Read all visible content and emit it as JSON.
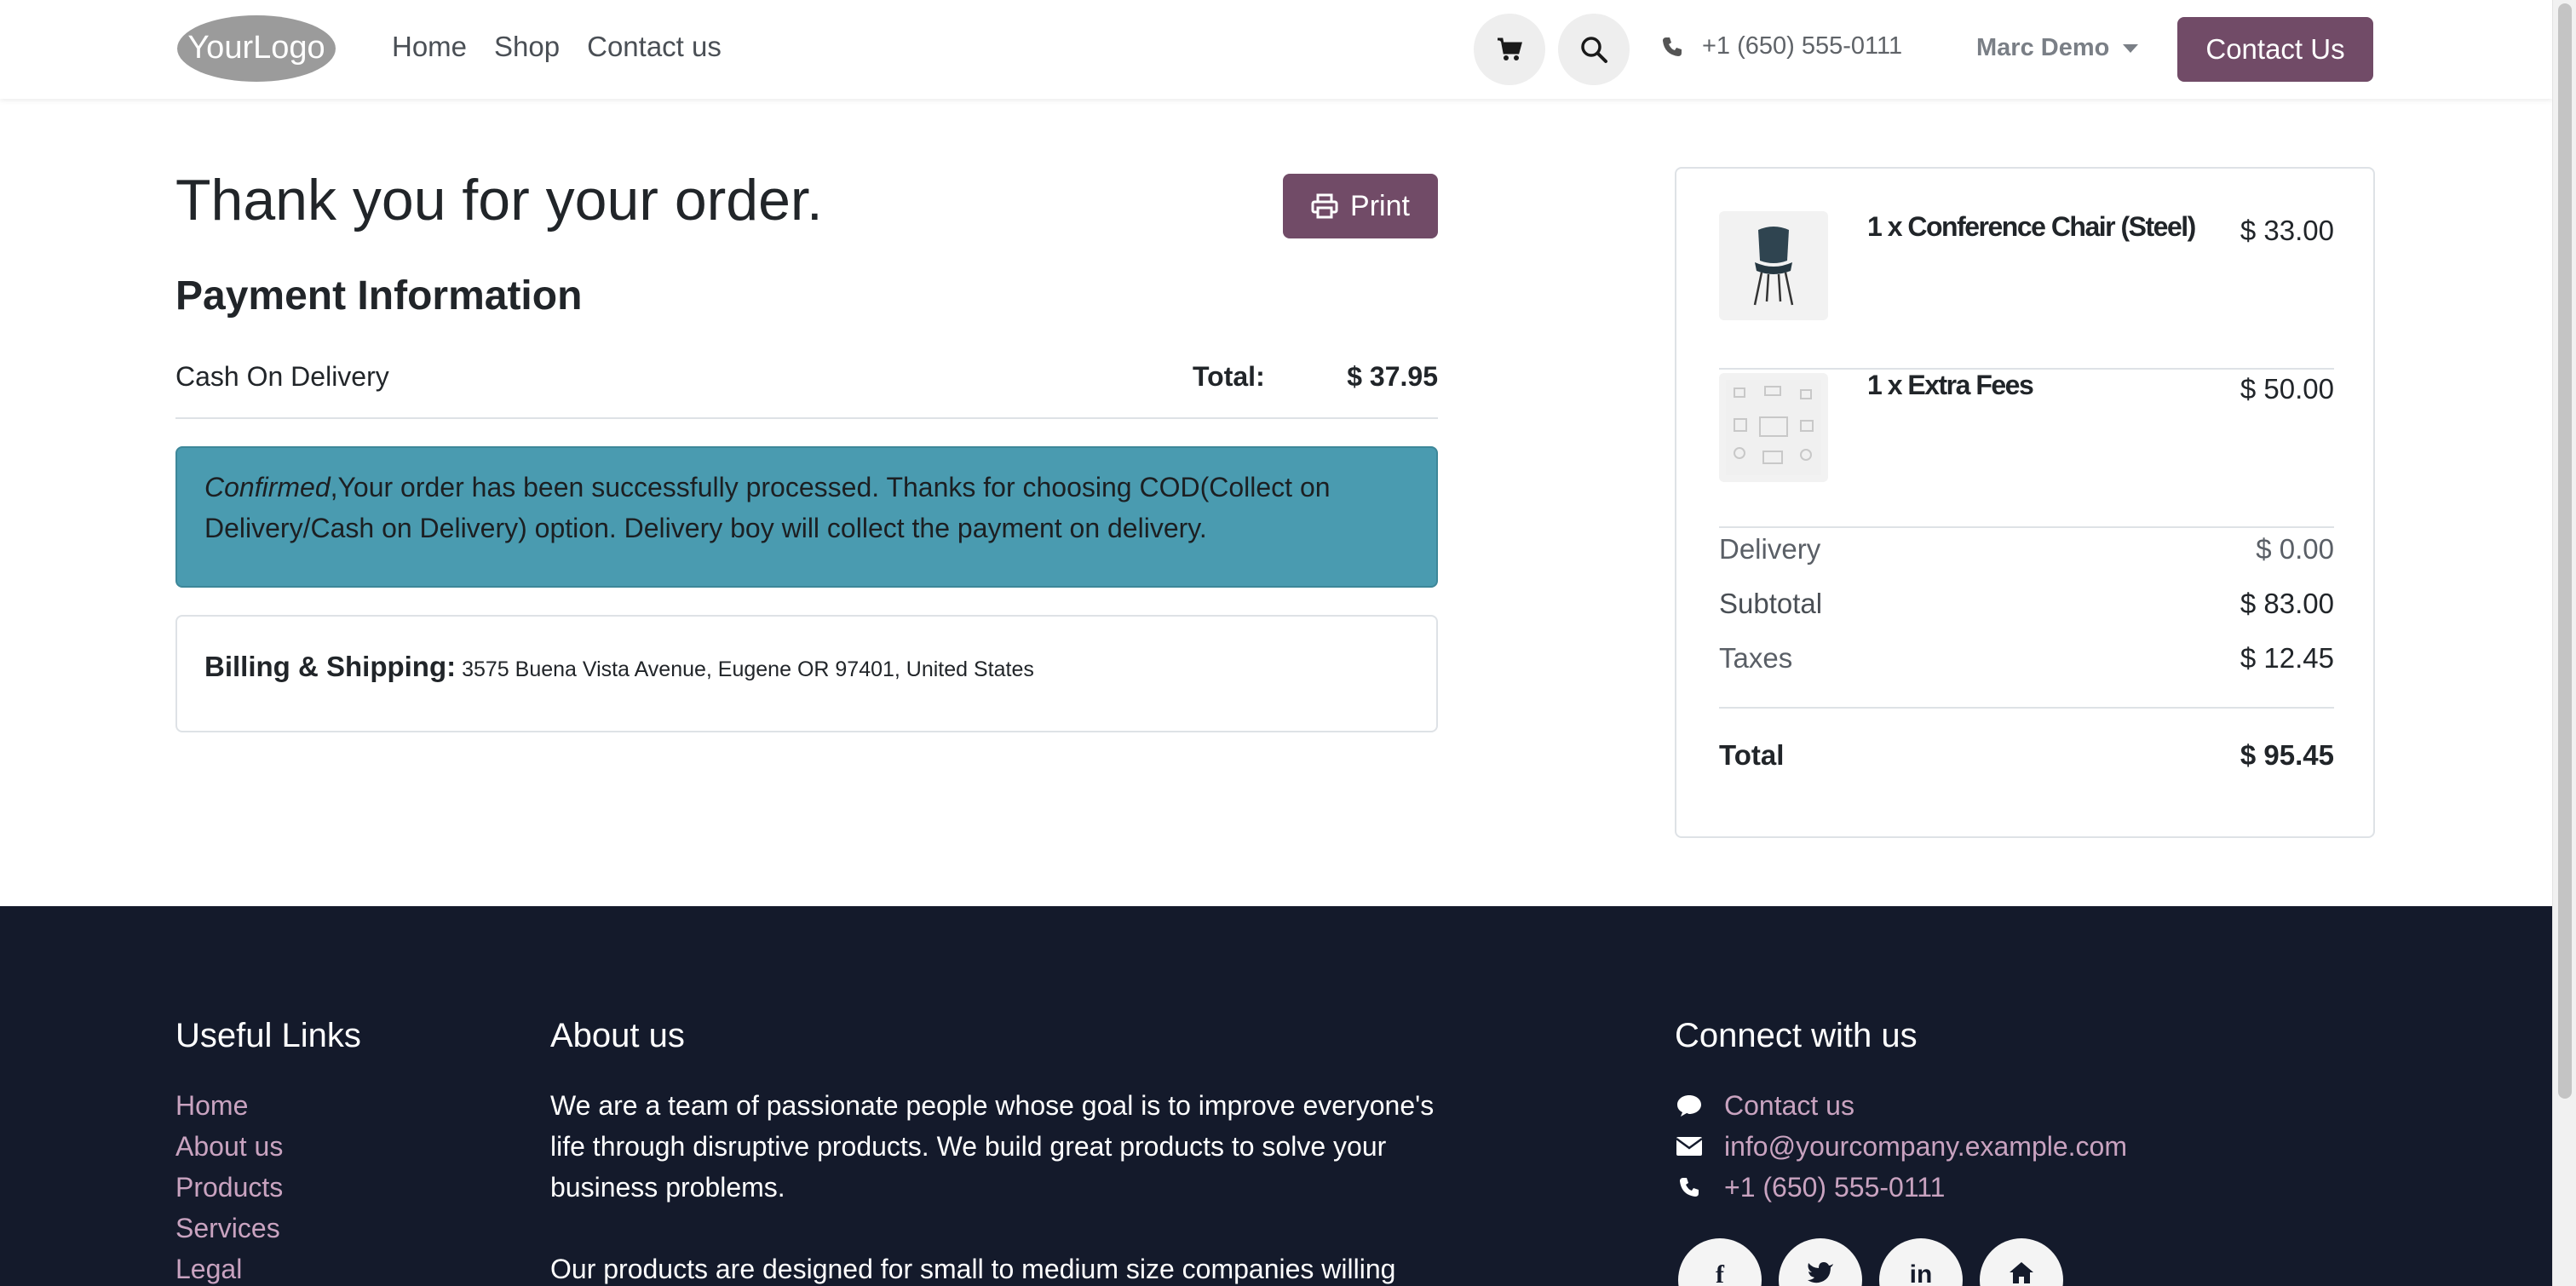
{
  "header": {
    "logo_text": "YourLogo",
    "nav": [
      "Home",
      "Shop",
      "Contact us"
    ],
    "phone": "+1 (650) 555-0111",
    "user": "Marc Demo",
    "contact_button": "Contact Us"
  },
  "main": {
    "title": "Thank you for your order.",
    "print_label": "Print",
    "payment_heading": "Payment Information",
    "payment_method": "Cash On Delivery",
    "total_label": "Total:",
    "total_value": "$ 37.95",
    "alert_emph": "Confirmed",
    "alert_text": ",Your order has been successfully processed. Thanks for choosing COD(Collect on Delivery/Cash on Delivery) option. Delivery boy will collect the payment on delivery.",
    "billing_label": "Billing & Shipping:",
    "billing_address": "3575 Buena Vista Avenue, Eugene OR 97401, United States"
  },
  "summary": {
    "items": [
      {
        "name": "1 x Conference Chair (Steel)",
        "price": "$ 33.00",
        "thumb_icon": "chair-icon"
      },
      {
        "name": "1 x Extra Fees",
        "price": "$ 50.00",
        "thumb_icon": "placeholder-image-icon"
      }
    ],
    "delivery_label": "Delivery",
    "delivery_value": "$ 0.00",
    "subtotal_label": "Subtotal",
    "subtotal_value": "$ 83.00",
    "taxes_label": "Taxes",
    "taxes_value": "$ 12.45",
    "total_label": "Total",
    "total_value": "$ 95.45"
  },
  "footer": {
    "useful_links_title": "Useful Links",
    "links": [
      "Home",
      "About us",
      "Products",
      "Services",
      "Legal"
    ],
    "about_title": "About us",
    "about_p1": "We are a team of passionate people whose goal is to improve everyone's life through disruptive products. We build great products to solve your business problems.",
    "about_p2": "Our products are designed for small to medium size companies willing",
    "connect_title": "Connect with us",
    "connect_contact": "Contact us",
    "connect_email": "info@yourcompany.example.com",
    "connect_phone": "+1 (650) 555-0111",
    "socials": [
      "f",
      "t",
      "in",
      "home"
    ]
  },
  "colors": {
    "brand": "#714b67",
    "alert_bg": "#4a9bb0",
    "footer_bg": "#141a2b",
    "link": "#c9a3c0"
  }
}
